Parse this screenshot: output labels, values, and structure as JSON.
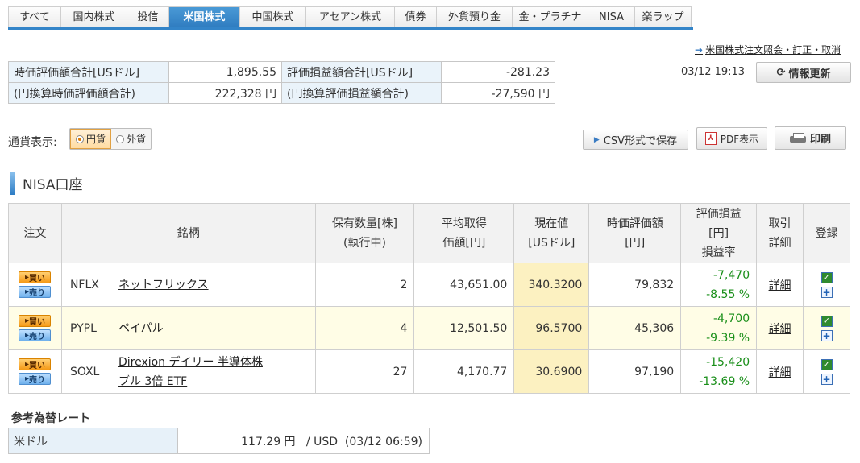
{
  "tabs": [
    {
      "label": "すべて",
      "active": false
    },
    {
      "label": "国内株式",
      "active": false
    },
    {
      "label": "投信",
      "active": false
    },
    {
      "label": "米国株式",
      "active": true
    },
    {
      "label": "中国株式",
      "active": false
    },
    {
      "label": "アセアン株式",
      "active": false
    },
    {
      "label": "債券",
      "active": false
    },
    {
      "label": "外貨預り金",
      "active": false
    },
    {
      "label": "金・プラチナ",
      "active": false
    },
    {
      "label": "NISA",
      "active": false
    },
    {
      "label": "楽ラップ",
      "active": false
    }
  ],
  "order_link": "米国株式注文照会・訂正・取消",
  "summary": {
    "market_value_usd_label": "時価評価額合計[USドル]",
    "market_value_usd": "1,895.55",
    "pl_usd_label": "評価損益額合計[USドル]",
    "pl_usd": "-281.23",
    "market_value_jpy_label": "(円換算時価評価額合計)",
    "market_value_jpy": "222,328 円",
    "pl_jpy_label": "(円換算評価損益額合計)",
    "pl_jpy": "-27,590 円"
  },
  "timestamp": "03/12 19:13",
  "refresh_label": "情報更新",
  "currency": {
    "label": "通貨表示:",
    "jpy": "円貨",
    "fx": "外貨",
    "selected": "円貨"
  },
  "csv_label": "CSV形式で保存",
  "pdf_label": "PDF表示",
  "print_label": "印刷",
  "section_title": "NISA口座",
  "headers": {
    "order": "注文",
    "name": "銘柄",
    "qty": [
      "保有数量[株]",
      "(執行中)"
    ],
    "avg": [
      "平均取得",
      "価額[円]"
    ],
    "price": [
      "現在値",
      "[USドル]"
    ],
    "value": [
      "時価評価額",
      "[円]"
    ],
    "pl": [
      "評価損益",
      "[円]",
      "損益率"
    ],
    "detail": [
      "取引",
      "詳細"
    ],
    "register": "登録"
  },
  "buy_label": "買い",
  "sell_label": "売り",
  "detail_label": "詳細",
  "rows": [
    {
      "ticker": "NFLX",
      "name": [
        "ネットフリックス"
      ],
      "qty": "2",
      "avg": "43,651.00",
      "price": "340.3200",
      "value": "79,832",
      "pl": "-7,470",
      "rate": "-8.55 %",
      "highlight": false
    },
    {
      "ticker": "PYPL",
      "name": [
        "ペイパル"
      ],
      "qty": "4",
      "avg": "12,501.50",
      "price": "96.5700",
      "value": "45,306",
      "pl": "-4,700",
      "rate": "-9.39 %",
      "highlight": true
    },
    {
      "ticker": "SOXL",
      "name": [
        "Direxion デイリー 半導体株",
        "ブル 3倍 ETF"
      ],
      "qty": "27",
      "avg": "4,170.77",
      "price": "30.6900",
      "value": "97,190",
      "pl": "-15,420",
      "rate": "-13.69 %",
      "highlight": false
    }
  ],
  "fx": {
    "title": "参考為替レート",
    "currency": "米ドル",
    "rate": "117.29 円",
    "unit": "/ USD",
    "time": "(03/12 06:59)"
  },
  "colors": {
    "tab_active": "#3384c8",
    "gain_loss": "#1a8f1a",
    "price_cell": "#fcf1c1",
    "highlight_row": "#fffde6"
  }
}
